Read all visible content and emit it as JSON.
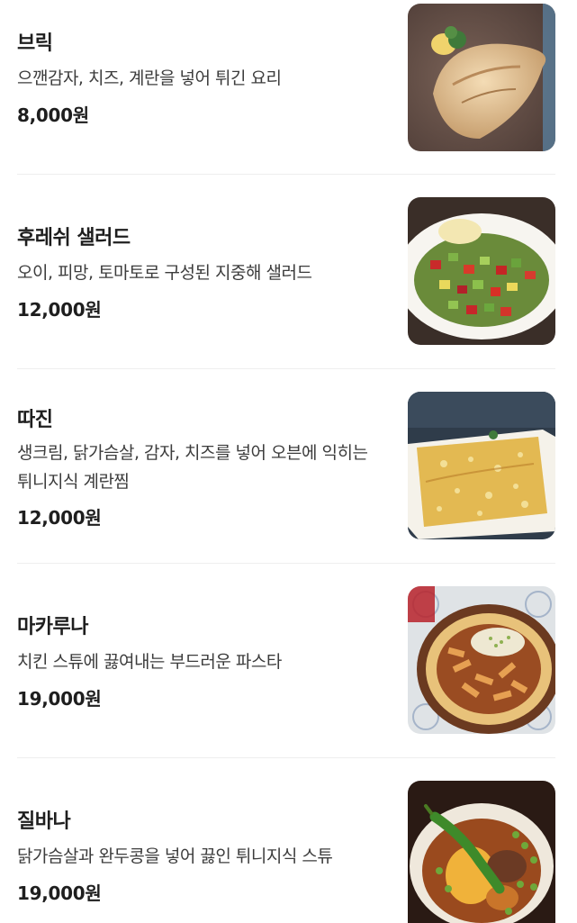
{
  "menu": {
    "items": [
      {
        "name": "브릭",
        "description": "으깬감자, 치즈, 계란을 넣어 튀긴 요리",
        "price": "8,000원",
        "image": "brik-photo"
      },
      {
        "name": "후레쉬 샐러드",
        "description": "오이, 피망, 토마토로 구성된 지중해 샐러드",
        "price": "12,000원",
        "image": "fresh-salad-photo"
      },
      {
        "name": "따진",
        "description": "생크림, 닭가슴살, 감자, 치즈를 넣어 오븐에 익히는 튀니지식 계란찜",
        "price": "12,000원",
        "image": "tajine-photo"
      },
      {
        "name": "마카루나",
        "description": "치킨 스튜에 끓여내는 부드러운 파스타",
        "price": "19,000원",
        "image": "makaruna-photo"
      },
      {
        "name": "질바나",
        "description": "닭가슴살과 완두콩을 넣어 끓인 튀니지식 스튜",
        "price": "19,000원",
        "image": "jelbana-photo"
      }
    ]
  }
}
